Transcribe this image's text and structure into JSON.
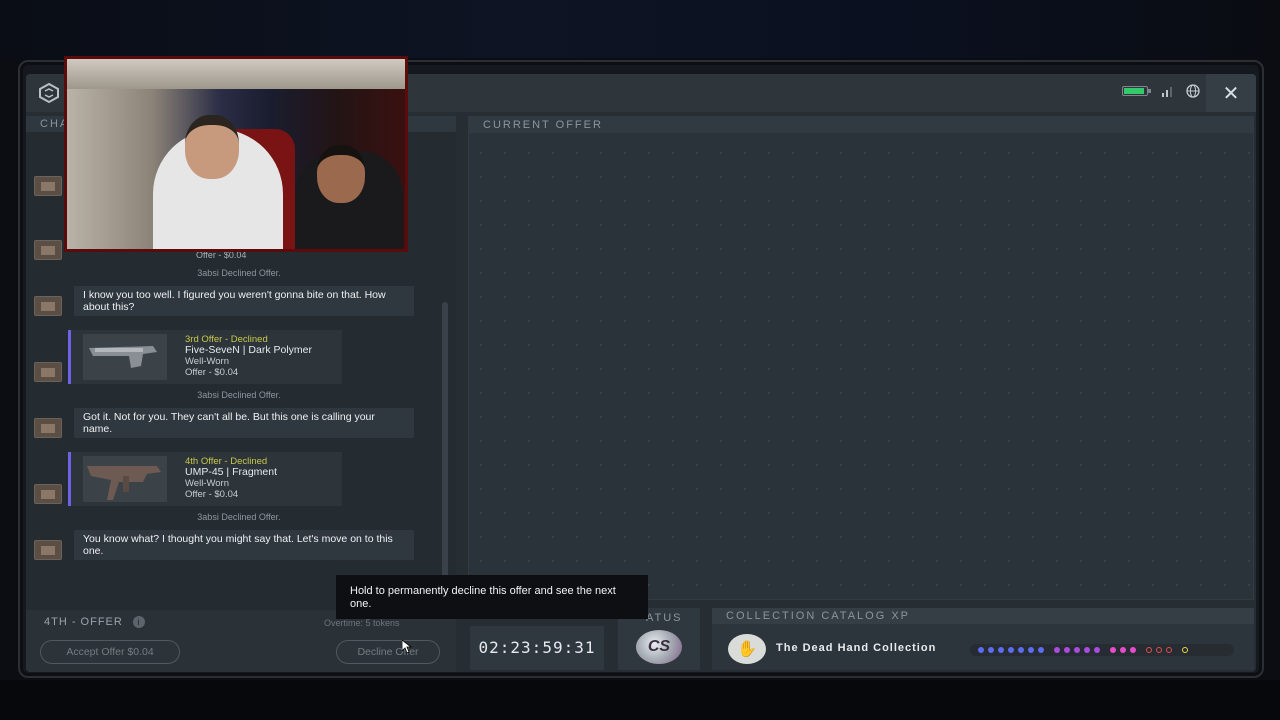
{
  "header": {
    "close_label": "✕"
  },
  "chat": {
    "header_label": "CHA",
    "messages": [
      {
        "type": "declined",
        "text": "3absi Declined Offer."
      },
      {
        "type": "bubble",
        "text": "I know you too well. I figured you weren't gonna bite on that. How about this?"
      },
      {
        "type": "offer",
        "label": "3rd Offer - Declined",
        "name": "Five-SeveN | Dark Polymer",
        "wear": "Well-Worn",
        "price": "Offer - $0.04"
      },
      {
        "type": "declined",
        "text": "3absi Declined Offer."
      },
      {
        "type": "bubble",
        "text": "Got it. Not for you. They can't all be. But this one is calling your name."
      },
      {
        "type": "offer",
        "label": "4th Offer - Declined",
        "name": "UMP-45 | Fragment",
        "wear": "Well-Worn",
        "price": "Offer - $0.04"
      },
      {
        "type": "declined",
        "text": "3absi Declined Offer."
      },
      {
        "type": "bubble",
        "text": "You know what? I thought you might say that. Let's move on to this one."
      }
    ],
    "partial_price": "Offer - $0.04",
    "footer": {
      "offer_count": "4TH - OFFER",
      "info_icon": "i",
      "overtime": "Overtime: 5 tokens",
      "accept_label": "Accept Offer $0.04",
      "decline_label": "Decline Offer"
    }
  },
  "tooltip": {
    "text": "Hold to permanently decline this offer and see the next one."
  },
  "current_offer": {
    "header_label": "CURRENT OFFER"
  },
  "timer": {
    "value": "02:23:59:31"
  },
  "status": {
    "label": "ATUS",
    "badge_text": "CS"
  },
  "catalog": {
    "header_label": "COLLECTION CATALOG XP",
    "collection_name": "The Dead Hand Collection",
    "dot_colors": [
      "#5b6cf0",
      "#5b6cf0",
      "#5b6cf0",
      "#5b6cf0",
      "#5b6cf0",
      "#5b6cf0",
      "#5b6cf0",
      "#a84ce0",
      "#a84ce0",
      "#a84ce0",
      "#a84ce0",
      "#a84ce0",
      "#e84ccc",
      "#e84ccc",
      "#e84ccc",
      "#e24c4c",
      "#e24c4c",
      "#e24c4c",
      "#e8d84c"
    ]
  },
  "colors": {
    "accent": "#6e62e6",
    "declined_label": "#c7c94a",
    "battery": "#34c96b"
  }
}
